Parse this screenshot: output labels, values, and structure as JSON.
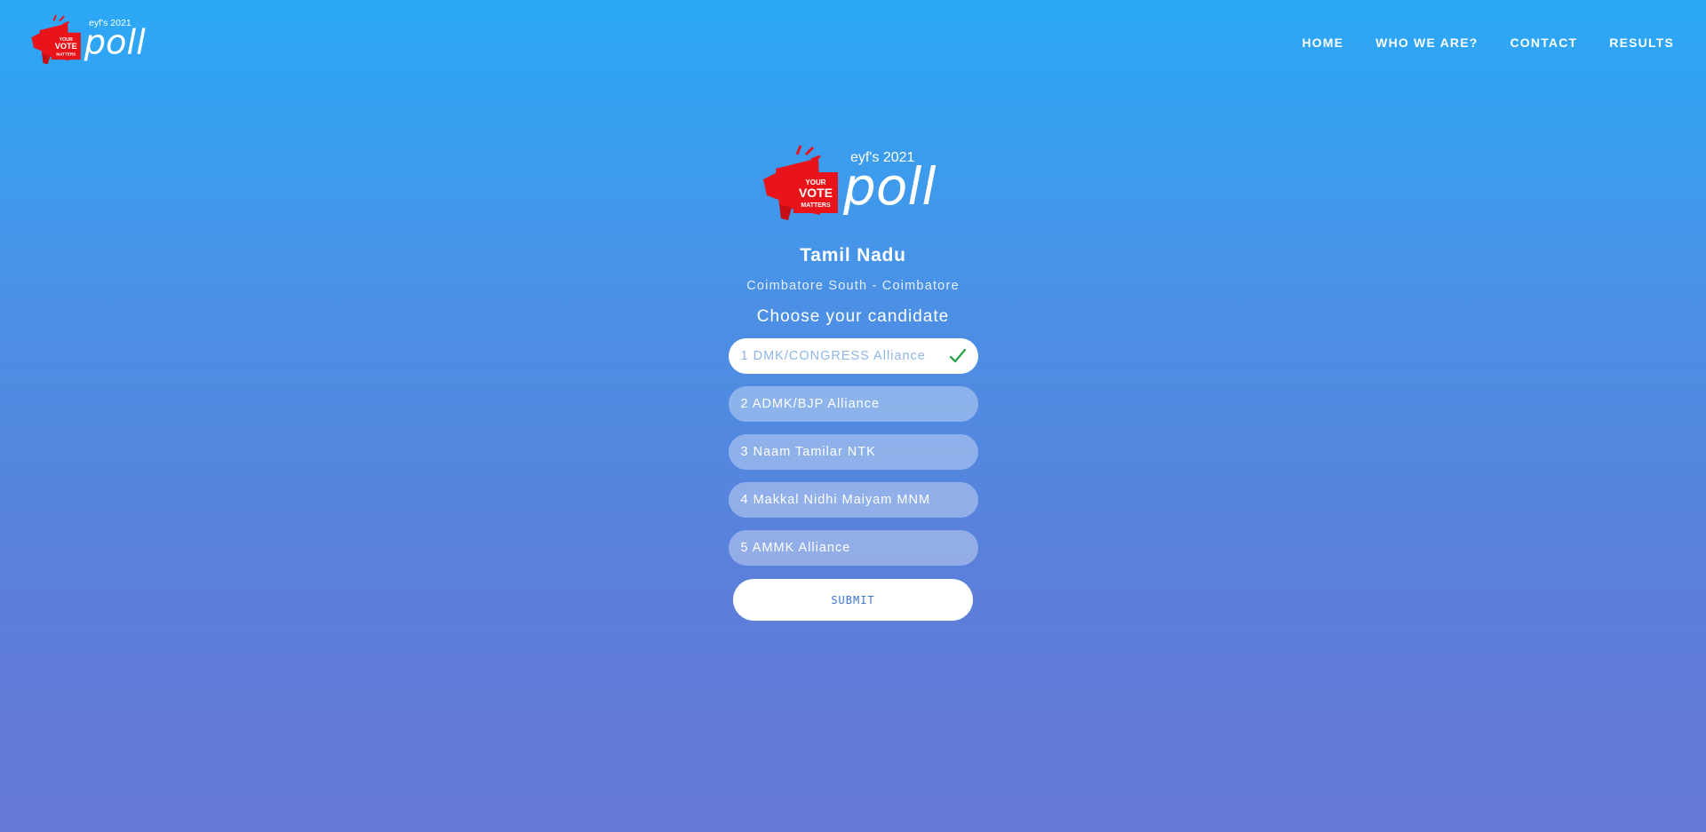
{
  "header": {
    "logo": {
      "tagline": "eyf's 2021",
      "word": "poll",
      "badge_line1": "YOUR",
      "badge_line2": "VOTE",
      "badge_line3": "MATTERS"
    },
    "nav": [
      {
        "label": "HOME"
      },
      {
        "label": "WHO WE ARE?"
      },
      {
        "label": "CONTACT"
      },
      {
        "label": "RESULTS"
      }
    ]
  },
  "main": {
    "logo": {
      "tagline": "eyf's 2021",
      "word": "poll",
      "badge_line1": "YOUR",
      "badge_line2": "VOTE",
      "badge_line3": "MATTERS"
    },
    "state": "Tamil Nadu",
    "constituency": "Coimbatore South - Coimbatore",
    "prompt": "Choose your candidate",
    "options": [
      {
        "label": "1 DMK/CONGRESS Alliance",
        "selected": true
      },
      {
        "label": "2 ADMK/BJP Alliance",
        "selected": false
      },
      {
        "label": "3 Naam Tamilar NTK",
        "selected": false
      },
      {
        "label": "4 Makkal Nidhi Maiyam MNM",
        "selected": false
      },
      {
        "label": "5 AMMK Alliance",
        "selected": false
      }
    ],
    "submit_label": "SUBMIT"
  },
  "colors": {
    "gradient_top": "#2aa9f7",
    "gradient_bottom": "#6677d4",
    "badge_red": "#e8141a",
    "check_green": "#2ea44f",
    "submit_text": "#3a78d0"
  },
  "icons": {
    "selected_indicator": "check-icon",
    "logo_mark": "megaphone-icon"
  }
}
